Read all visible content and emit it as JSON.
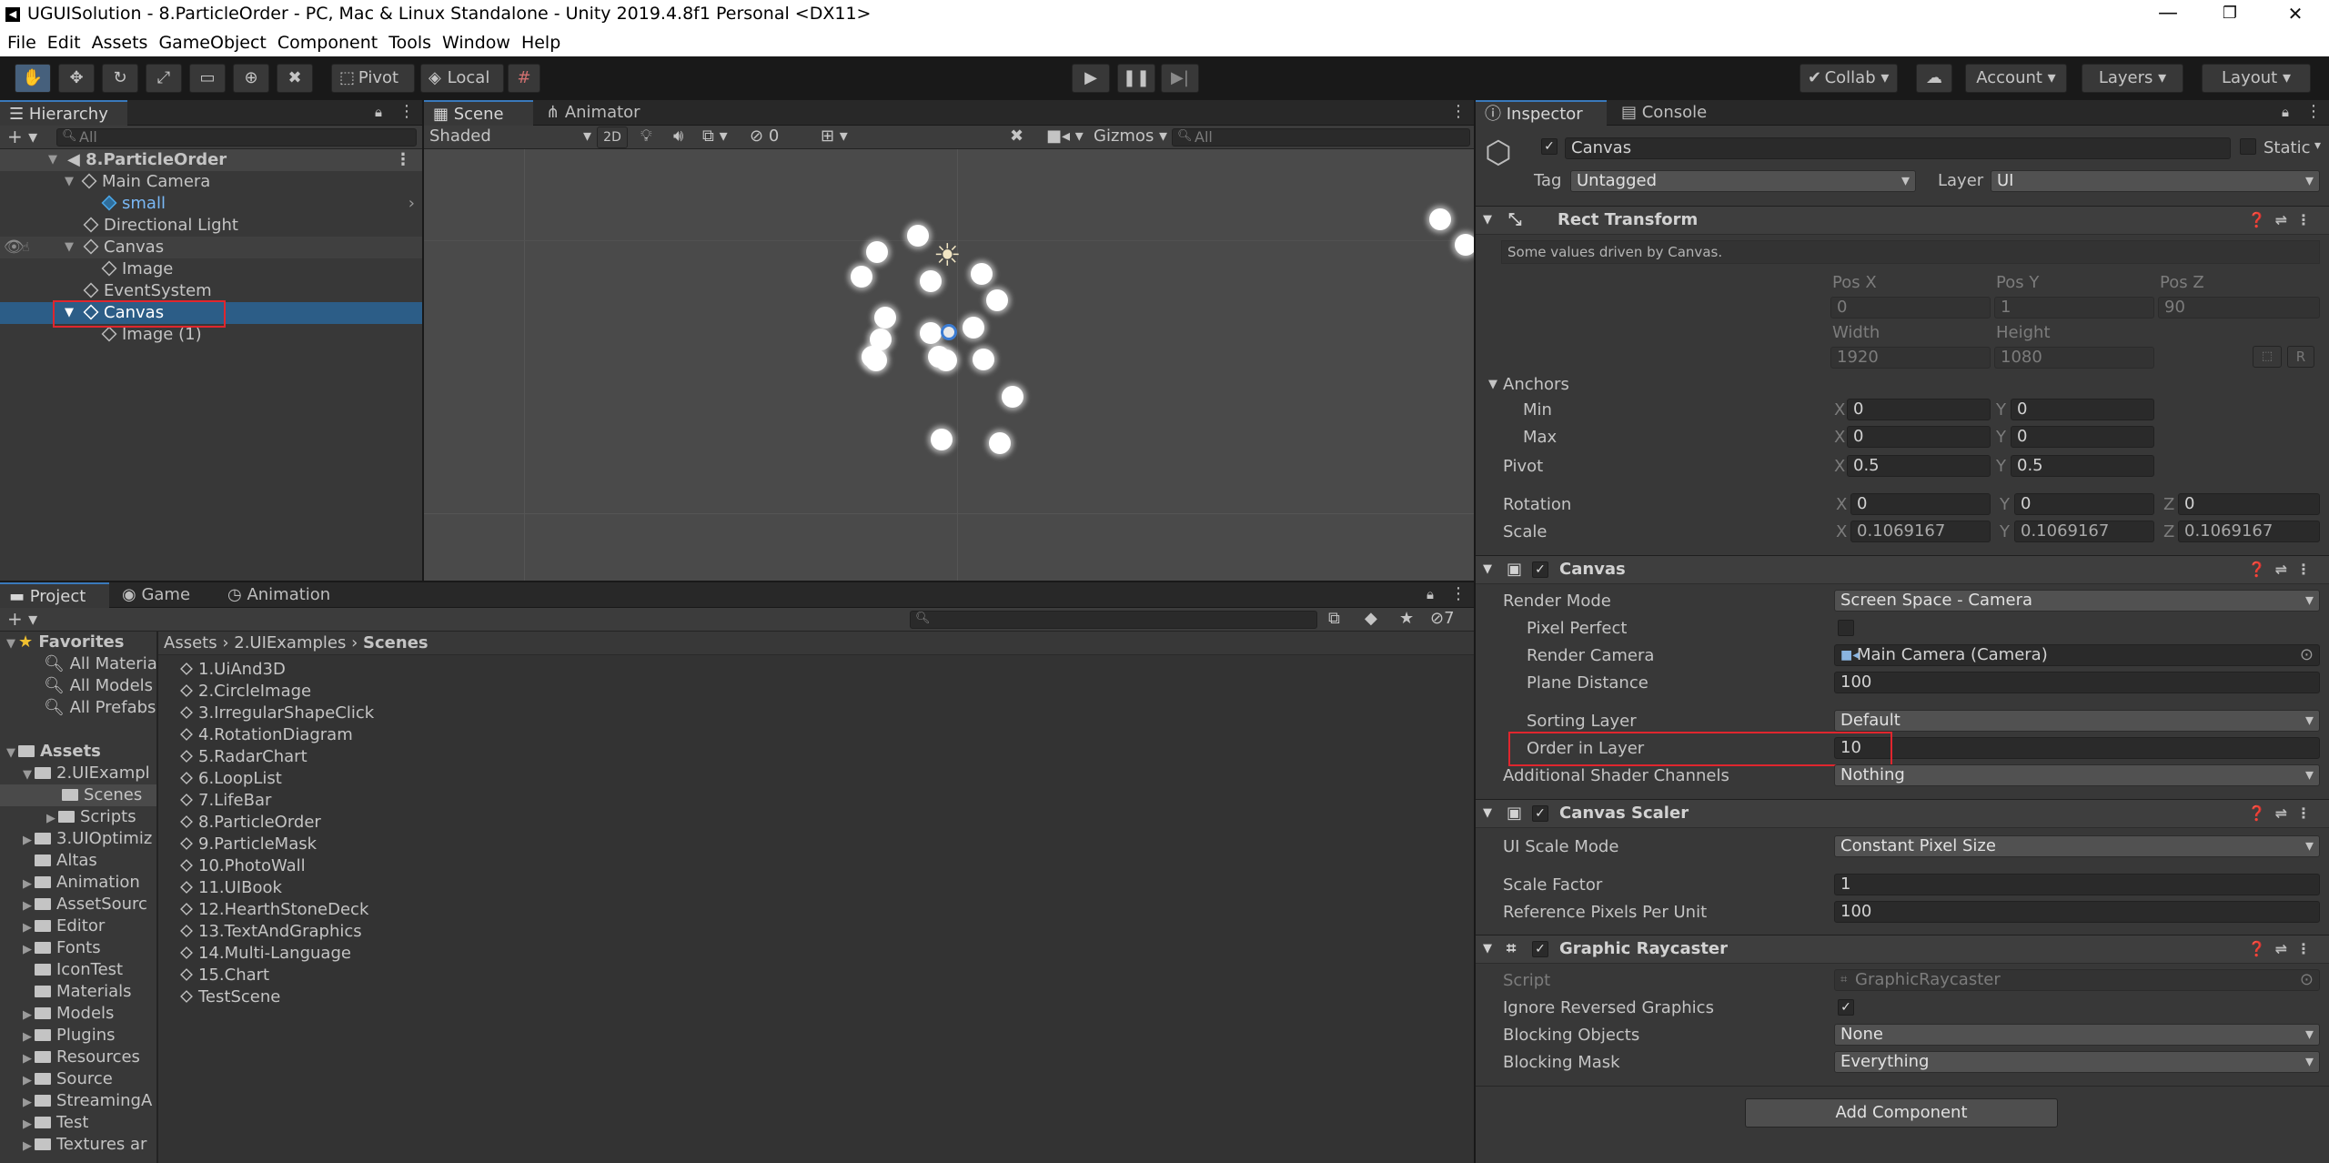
{
  "window": {
    "title": "UGUISolution - 8.ParticleOrder - PC, Mac & Linux Standalone - Unity 2019.4.8f1 Personal <DX11>",
    "minimize": "—",
    "maximize": "❐",
    "close": "✕"
  },
  "menu": [
    "File",
    "Edit",
    "Assets",
    "GameObject",
    "Component",
    "Tools",
    "Window",
    "Help"
  ],
  "toolbar": {
    "pivot": "Pivot",
    "local": "Local",
    "collab": "Collab",
    "account": "Account",
    "layers": "Layers",
    "layout": "Layout"
  },
  "hierarchy": {
    "tab": "Hierarchy",
    "search_placeholder": "All",
    "rows": [
      {
        "label": "8.ParticleOrder"
      },
      {
        "label": "Main Camera"
      },
      {
        "label": "small"
      },
      {
        "label": "Directional Light"
      },
      {
        "label": "Canvas"
      },
      {
        "label": "Image"
      },
      {
        "label": "EventSystem"
      },
      {
        "label": "Canvas"
      },
      {
        "label": "Image (1)"
      }
    ]
  },
  "scene": {
    "tabs": [
      "Scene",
      "Animator"
    ],
    "shading": "Shaded",
    "mode2d": "2D",
    "hidden_count": "0",
    "gizmos": "Gizmos",
    "search_placeholder": "All"
  },
  "project": {
    "tabs": [
      "Project",
      "Game",
      "Animation"
    ],
    "hidden_count": "7",
    "favorites": {
      "label": "Favorites",
      "items": [
        "All Material",
        "All Models",
        "All Prefabs"
      ]
    },
    "assets_label": "Assets",
    "tree": [
      "2.UIExampl",
      "Scenes",
      "Scripts",
      "3.UIOptimiz",
      "Altas",
      "Animation",
      "AssetSourc",
      "Editor",
      "Fonts",
      "IconTest",
      "Materials",
      "Models",
      "Plugins",
      "Resources",
      "Source",
      "StreamingA",
      "Test",
      "Textures ar"
    ],
    "breadcrumb": [
      "Assets",
      "2.UIExamples",
      "Scenes"
    ],
    "files": [
      "1.UiAnd3D",
      "2.CircleImage",
      "3.IrregularShapeClick",
      "4.RotationDiagram",
      "5.RadarChart",
      "6.LoopList",
      "7.LifeBar",
      "8.ParticleOrder",
      "9.ParticleMask",
      "10.PhotoWall",
      "11.UIBook",
      "12.HearthStoneDeck",
      "13.TextAndGraphics",
      "14.Multi-Language",
      "15.Chart",
      "TestScene"
    ]
  },
  "inspector": {
    "tabs": [
      "Inspector",
      "Console"
    ],
    "object": {
      "name": "Canvas",
      "static_label": "Static",
      "tag_label": "Tag",
      "tag": "Untagged",
      "layer_label": "Layer",
      "layer": "UI"
    },
    "rect_transform": {
      "title": "Rect Transform",
      "note": "Some values driven by Canvas.",
      "pos_x_label": "Pos X",
      "pos_y_label": "Pos Y",
      "pos_z_label": "Pos Z",
      "pos_x": "0",
      "pos_y": "1",
      "pos_z": "90",
      "width_label": "Width",
      "height_label": "Height",
      "width": "1920",
      "height": "1080",
      "anchors_label": "Anchors",
      "min_label": "Min",
      "max_label": "Max",
      "min_x": "0",
      "min_y": "0",
      "max_x": "0",
      "max_y": "0",
      "pivot_label": "Pivot",
      "pivot_x": "0.5",
      "pivot_y": "0.5",
      "rotation_label": "Rotation",
      "rot_x": "0",
      "rot_y": "0",
      "rot_z": "0",
      "scale_label": "Scale",
      "scale_x": "0.1069167",
      "scale_y": "0.1069167",
      "scale_z": "0.1069167",
      "x": "X",
      "y": "Y",
      "z": "Z",
      "r": "R"
    },
    "canvas": {
      "title": "Canvas",
      "render_mode_label": "Render Mode",
      "render_mode": "Screen Space - Camera",
      "pixel_perfect_label": "Pixel Perfect",
      "render_camera_label": "Render Camera",
      "render_camera": "Main Camera (Camera)",
      "plane_distance_label": "Plane Distance",
      "plane_distance": "100",
      "sorting_layer_label": "Sorting Layer",
      "sorting_layer": "Default",
      "order_label": "Order in Layer",
      "order": "10",
      "shader_channels_label": "Additional Shader Channels",
      "shader_channels": "Nothing"
    },
    "canvas_scaler": {
      "title": "Canvas Scaler",
      "scale_mode_label": "UI Scale Mode",
      "scale_mode": "Constant Pixel Size",
      "scale_factor_label": "Scale Factor",
      "scale_factor": "1",
      "ref_ppu_label": "Reference Pixels Per Unit",
      "ref_ppu": "100"
    },
    "raycaster": {
      "title": "Graphic Raycaster",
      "script_label": "Script",
      "script": "GraphicRaycaster",
      "ignore_label": "Ignore Reversed Graphics",
      "blocking_objects_label": "Blocking Objects",
      "blocking_objects": "None",
      "blocking_mask_label": "Blocking Mask",
      "blocking_mask": "Everything"
    },
    "add_component": "Add Component"
  }
}
